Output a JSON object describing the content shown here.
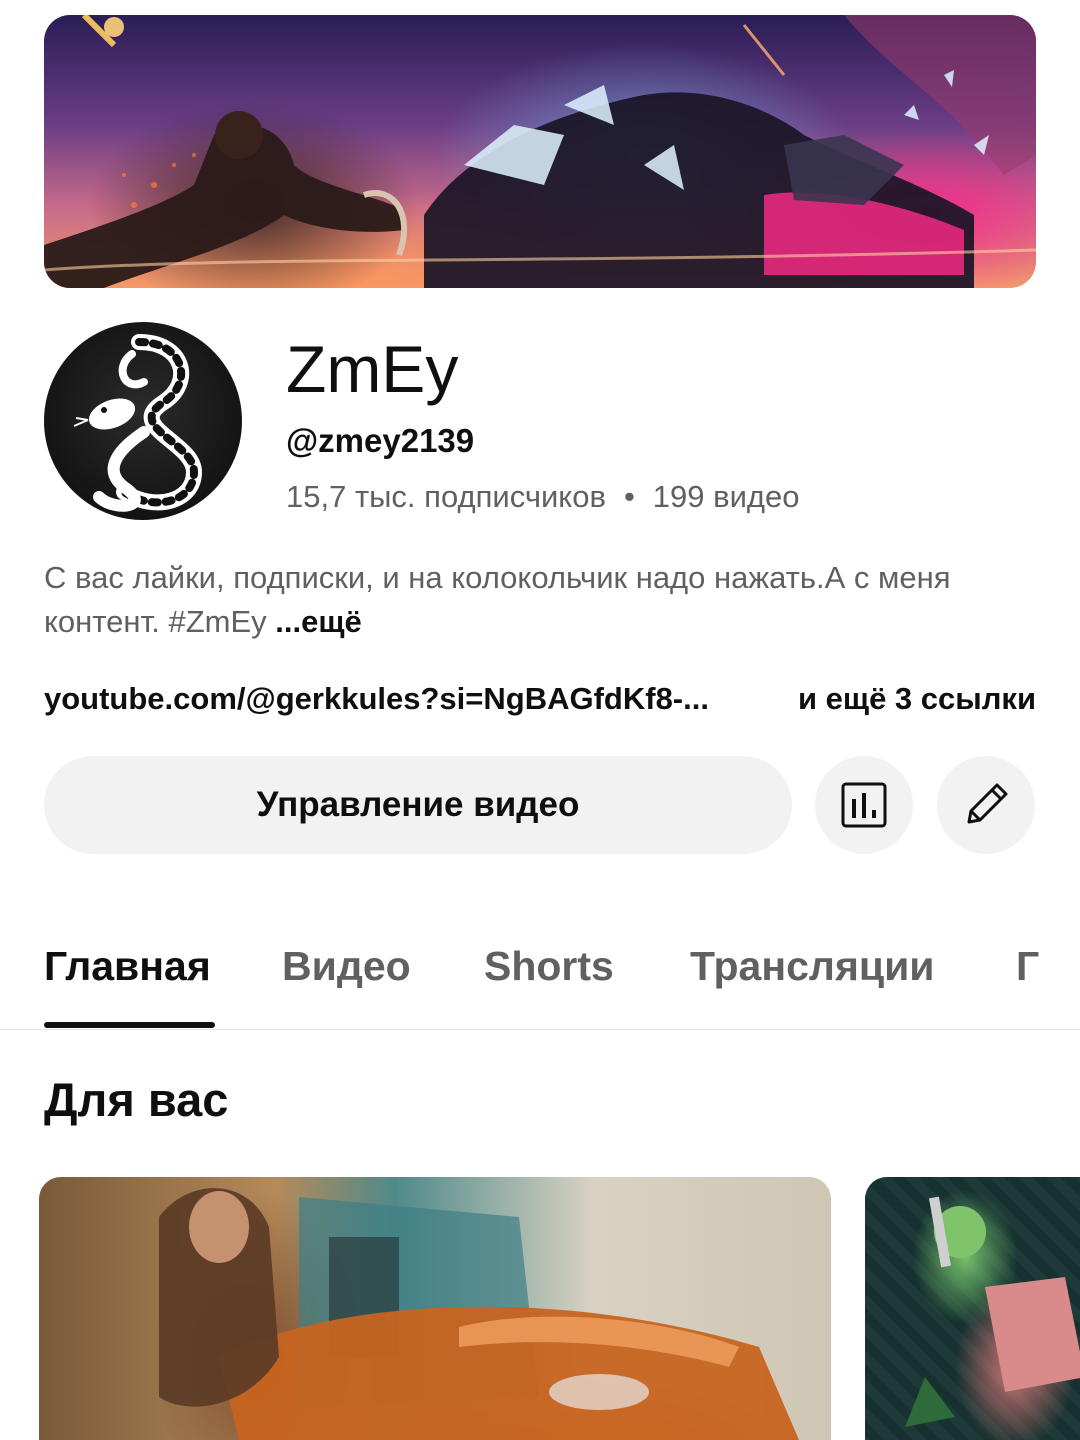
{
  "channel": {
    "name": "ZmEy",
    "handle": "@zmey2139",
    "subscribers": "15,7 тыс. подписчиков",
    "separator": "•",
    "videos": "199 видео",
    "description": "С вас лайки, подписки, и на колокольчик надо нажать.А с меня контент. #ZmEy",
    "description_more": "...ещё",
    "link": "youtube.com/@gerkkules?si=NgBAGfdKf8-...",
    "more_links": "и ещё 3 ссылки"
  },
  "actions": {
    "manage_videos": "Управление видео",
    "stats_icon": "bar-chart-icon",
    "edit_icon": "pencil-icon"
  },
  "tabs": [
    {
      "label": "Главная",
      "active": true
    },
    {
      "label": "Видео",
      "active": false
    },
    {
      "label": "Shorts",
      "active": false
    },
    {
      "label": "Трансляции",
      "active": false
    },
    {
      "label": "Г",
      "active": false
    }
  ],
  "section": {
    "title": "Для вас"
  },
  "colors": {
    "text_primary": "#0f0f0f",
    "text_secondary": "#606060",
    "button_bg": "#f2f2f2"
  }
}
